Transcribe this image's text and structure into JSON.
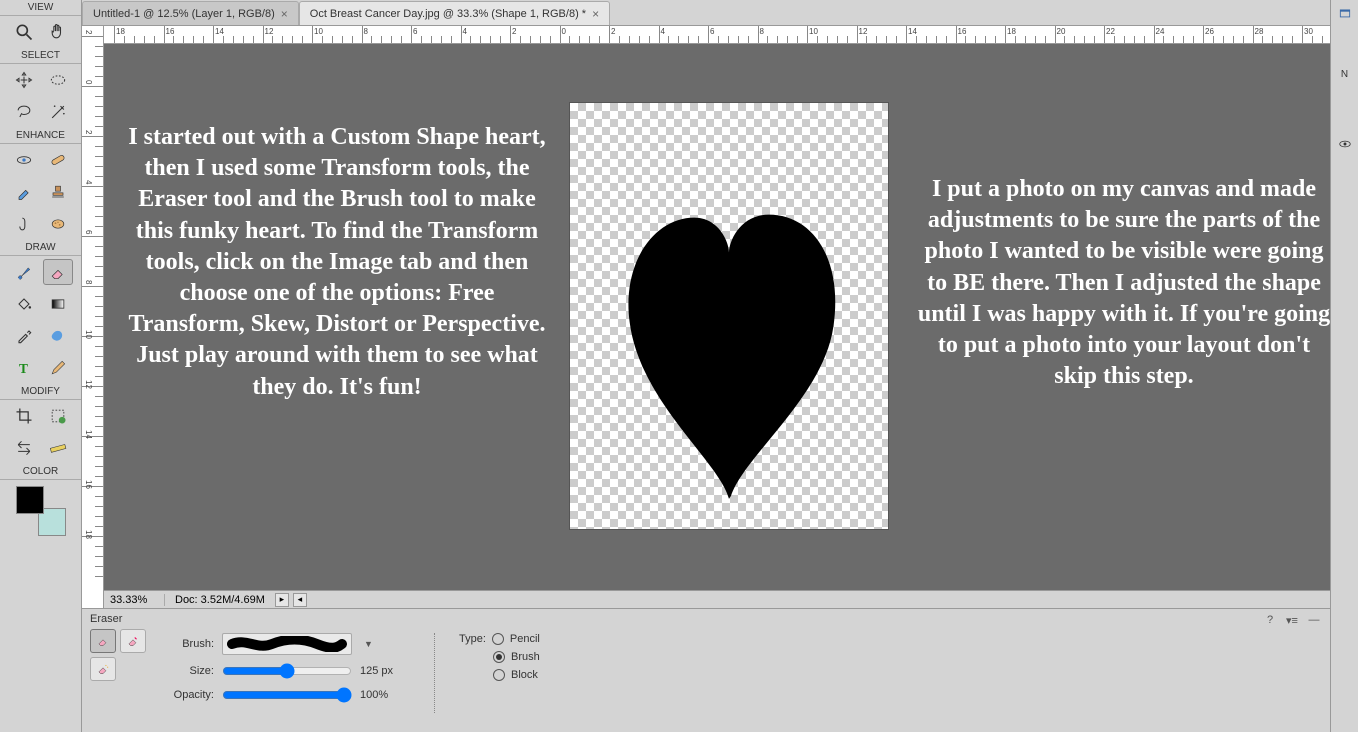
{
  "toolbox": {
    "sections": {
      "view": "VIEW",
      "select": "SELECT",
      "enhance": "ENHANCE",
      "draw": "DRAW",
      "modify": "MODIFY",
      "color": "COLOR"
    }
  },
  "tabs": [
    {
      "label": "Untitled-1 @ 12.5% (Layer 1, RGB/8)",
      "active": false
    },
    {
      "label": "Oct Breast Cancer Day.jpg @ 33.3% (Shape 1, RGB/8) *",
      "active": true
    }
  ],
  "ruler": {
    "horizontal": [
      "18",
      "16",
      "14",
      "12",
      "10",
      "8",
      "6",
      "4",
      "2",
      "0",
      "2",
      "4",
      "6",
      "8",
      "10",
      "12",
      "14",
      "16",
      "18",
      "20",
      "22",
      "24",
      "26",
      "28",
      "30"
    ],
    "vertical": [
      "2",
      "0",
      "2",
      "4",
      "6",
      "8",
      "10",
      "12",
      "14",
      "16",
      "18"
    ]
  },
  "annotations": {
    "left": "I started out with a Custom Shape heart, then I used some Transform tools, the Eraser tool and the Brush tool to make this funky heart. To find the Transform tools, click on the Image tab and then choose one of the options: Free Transform, Skew, Distort or Perspective. Just play around with them to see what they do. It's fun!",
    "right": "I put a photo on my canvas and made adjustments to be sure the parts of the photo I wanted to be visible were going to BE there. Then I adjusted the shape until I was happy with it. If you're going to put a photo into your layout don't skip this step."
  },
  "status": {
    "zoom": "33.33%",
    "doc": "Doc: 3.52M/4.69M"
  },
  "options": {
    "title": "Eraser",
    "brush_label": "Brush:",
    "size_label": "Size:",
    "size_value": "125 px",
    "opacity_label": "Opacity:",
    "opacity_value": "100%",
    "type_label": "Type:",
    "types": {
      "pencil": "Pencil",
      "brush": "Brush",
      "block": "Block"
    },
    "selected_type": "brush"
  },
  "right_panel": {
    "navigator_short": "N"
  }
}
